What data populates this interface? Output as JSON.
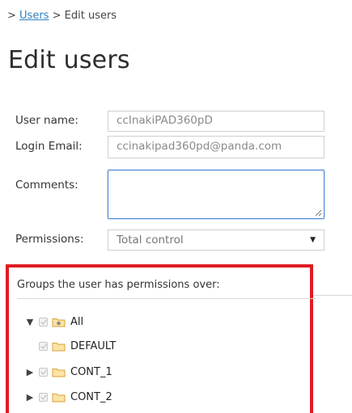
{
  "breadcrumb": {
    "separator": ">",
    "link": "Users",
    "current": "Edit users"
  },
  "page_title": "Edit users",
  "form": {
    "username_label": "User name:",
    "username_value": "ccInakiPAD360pD",
    "email_label": "Login Email:",
    "email_value": "ccinakipad360pd@panda.com",
    "comments_label": "Comments:",
    "comments_value": "",
    "permissions_label": "Permissions:",
    "permissions_value": "Total control"
  },
  "groups": {
    "title": "Groups the user has permissions over:",
    "tree": [
      {
        "label": "All",
        "expanded": true,
        "icon": "root-folder-icon",
        "checked": true
      },
      {
        "label": "DEFAULT",
        "expanded": null,
        "icon": "folder-icon",
        "checked": true
      },
      {
        "label": "CONT_1",
        "expanded": false,
        "icon": "folder-icon",
        "checked": true
      },
      {
        "label": "CONT_2",
        "expanded": false,
        "icon": "folder-icon",
        "checked": true
      }
    ]
  },
  "colors": {
    "link": "#2e7fc1",
    "highlight_border": "#e01b24",
    "focus_border": "#4a86d8",
    "folder_fill": "#fbe3a3",
    "folder_stroke": "#d8a23c"
  },
  "icons": {
    "expanded": "▼",
    "collapsed": "▶",
    "select_arrow": "▼"
  }
}
